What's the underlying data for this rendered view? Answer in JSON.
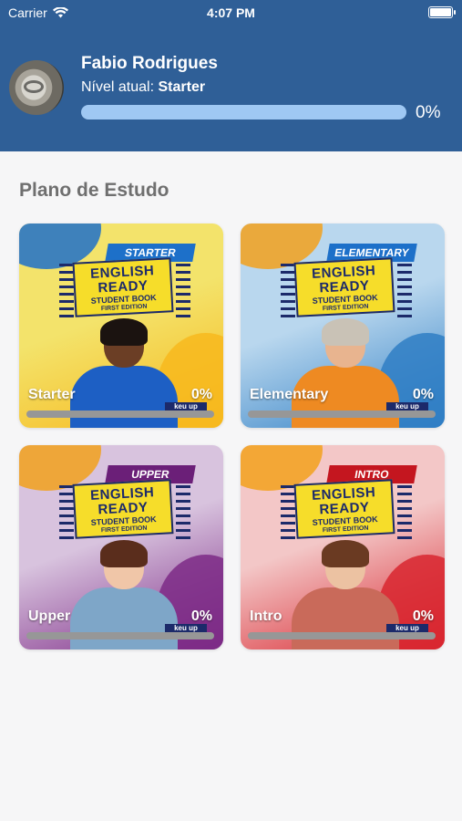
{
  "status_bar": {
    "carrier": "Carrier",
    "time": "4:07 PM"
  },
  "profile": {
    "name": "Fabio Rodrigues",
    "level_label": "Nível atual:",
    "level_value": "Starter",
    "progress": 0,
    "progress_text": "0%"
  },
  "section_title": "Plano de Estudo",
  "cover": {
    "line1": "ENGLISH",
    "line2": "READY",
    "line3": "STUDENT BOOK",
    "line4": "FIRST EDITION",
    "publisher": "keu up"
  },
  "courses": [
    {
      "name": "Starter",
      "badge": "STARTER",
      "progress": 0,
      "progress_text": "0%",
      "bg_from": "#f3e36b",
      "bg_to": "#f7b81d",
      "accent": "#1d70c9",
      "badge_color": "#1d70c9",
      "skin": "#6b3e25",
      "hair": "#1b1310",
      "shirt": "#1d5fc4"
    },
    {
      "name": "Elementary",
      "badge": "ELEMENTARY",
      "progress": 0,
      "progress_text": "0%",
      "bg_from": "#b9d7ee",
      "bg_to": "#2f7ec4",
      "accent": "#f2a11c",
      "badge_color": "#1d70c9",
      "skin": "#e8b48f",
      "hair": "#c9c2b6",
      "shirt": "#ee8a22"
    },
    {
      "name": "Upper",
      "badge": "UPPER",
      "progress": 0,
      "progress_text": "0%",
      "bg_from": "#d8c3de",
      "bg_to": "#7d2a86",
      "accent": "#f2a11c",
      "badge_color": "#6b1f78",
      "skin": "#f0c6a8",
      "hair": "#5a2d1c",
      "shirt": "#7ea6c8"
    },
    {
      "name": "Intro",
      "badge": "INTRO",
      "progress": 0,
      "progress_text": "0%",
      "bg_from": "#f3c7c7",
      "bg_to": "#d8262f",
      "accent": "#f2a11c",
      "badge_color": "#c4161f",
      "skin": "#ecc2a2",
      "hair": "#6a3a22",
      "shirt": "#c96a5a"
    }
  ]
}
